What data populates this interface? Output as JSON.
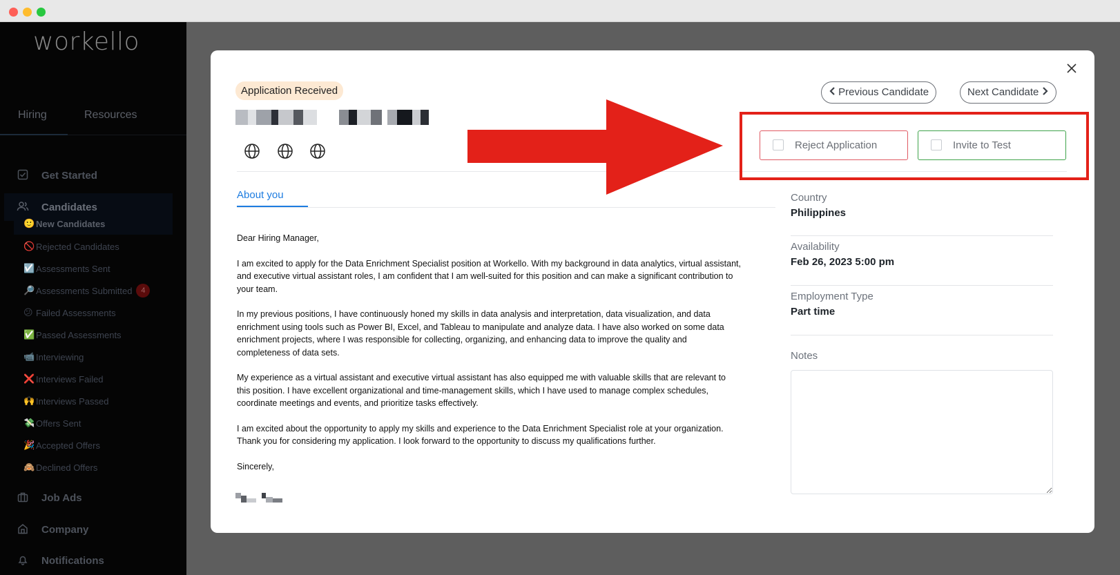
{
  "sidebar": {
    "logo": "workello",
    "tabs": [
      {
        "label": "Hiring"
      },
      {
        "label": "Resources"
      }
    ],
    "items": [
      {
        "label": "Get Started",
        "icon": "checkbox-icon"
      },
      {
        "label": "Candidates",
        "icon": "users-icon"
      },
      {
        "label": "Job Ads",
        "icon": "briefcase-icon"
      },
      {
        "label": "Company",
        "icon": "building-icon"
      },
      {
        "label": "Notifications",
        "icon": "bell-icon"
      }
    ],
    "candidate_filters": [
      {
        "emoji": "🙂",
        "label": "New Candidates"
      },
      {
        "emoji": "🚫",
        "label": "Rejected Candidates"
      },
      {
        "emoji": "☑️",
        "label": "Assessments Sent"
      },
      {
        "emoji": "🔎",
        "label": "Assessments Submitted",
        "badge": "4"
      },
      {
        "emoji": "😕",
        "label": "Failed Assessments"
      },
      {
        "emoji": "✅",
        "label": "Passed Assessments"
      },
      {
        "emoji": "📹",
        "label": "Interviewing"
      },
      {
        "emoji": "❌",
        "label": "Interviews Failed"
      },
      {
        "emoji": "🙌",
        "label": "Interviews Passed"
      },
      {
        "emoji": "💸",
        "label": "Offers Sent"
      },
      {
        "emoji": "🎉",
        "label": "Accepted Offers"
      },
      {
        "emoji": "🙈",
        "label": "Declined Offers"
      }
    ]
  },
  "modal": {
    "status": "Application Received",
    "prev_label": "Previous Candidate",
    "next_label": "Next Candidate",
    "reject_label": "Reject Application",
    "invite_label": "Invite to Test",
    "about_tab": "About you",
    "letter": [
      "Dear Hiring Manager,",
      "I am excited to apply for the Data Enrichment Specialist position at Workello. With my background in data analytics, virtual assistant, and executive virtual assistant roles, I am confident that I am well-suited for this position and can make a significant contribution to your team.",
      "In my previous positions, I have continuously honed my skills in data analysis and interpretation, data visualization, and data enrichment using tools such as Power BI, Excel, and Tableau to manipulate and analyze data. I have also worked on some data enrichment projects, where I was responsible for collecting, organizing, and enhancing data to improve the quality and completeness of data sets.",
      "My experience as a virtual assistant and executive virtual assistant has also equipped me with valuable skills that are relevant to this position. I have excellent organizational and time-management skills, which I have used to manage complex schedules, coordinate meetings and events, and prioritize tasks effectively.",
      "I am excited about the opportunity to apply my skills and experience to the Data Enrichment Specialist role at your organization. Thank you for considering my application. I look forward to the opportunity to discuss my qualifications further.",
      "Sincerely,"
    ],
    "details": {
      "country_label": "Country",
      "country": "Philippines",
      "availability_label": "Availability",
      "availability": "Feb 26, 2023 5:00 pm",
      "employment_label": "Employment Type",
      "employment": "Part time",
      "notes_label": "Notes"
    }
  },
  "colors": {
    "accent": "#1d7ce0",
    "reject_border": "#e05962",
    "invite_border": "#3ea34a",
    "annotation_red": "#e32119",
    "status_badge_bg": "#fde9d3"
  }
}
